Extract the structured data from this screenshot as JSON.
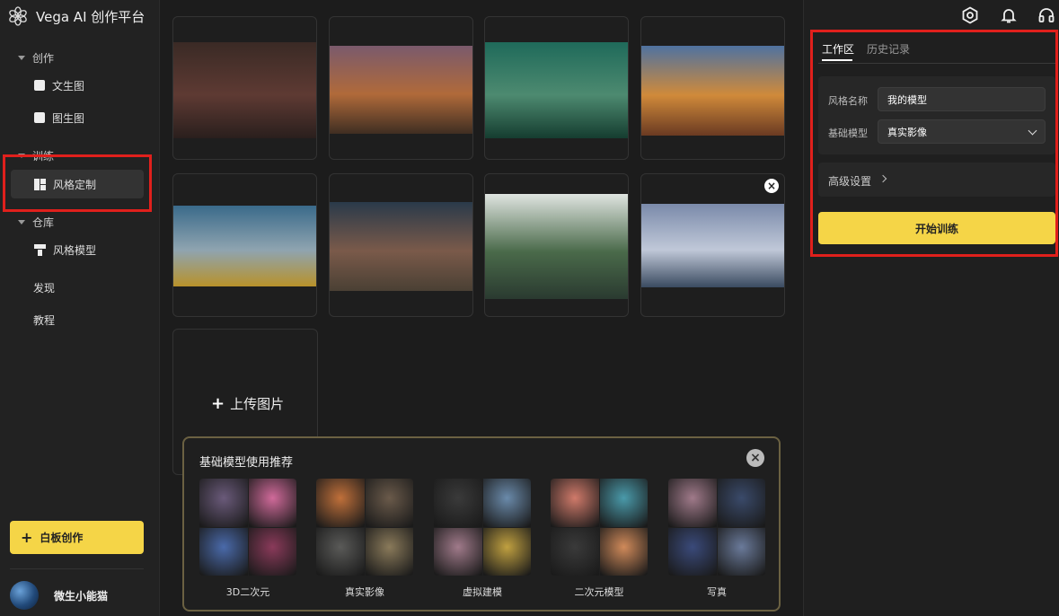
{
  "app": {
    "title": "Vega AI 创作平台"
  },
  "sidebar": {
    "groups": [
      {
        "label": "创作",
        "items": [
          {
            "label": "文生图",
            "icon": "image-text-icon"
          },
          {
            "label": "图生图",
            "icon": "image-icon"
          }
        ]
      },
      {
        "label": "训练",
        "items": [
          {
            "label": "风格定制",
            "icon": "style-custom-icon",
            "active": true
          }
        ]
      },
      {
        "label": "仓库",
        "items": [
          {
            "label": "风格模型",
            "icon": "style-model-icon"
          }
        ]
      }
    ],
    "plain_items": [
      "发现",
      "教程"
    ],
    "whiteboard_button": "白板创作",
    "user": {
      "name": "微生小能猫"
    }
  },
  "main": {
    "images": [
      {
        "name": "berry-branch",
        "colors": [
          "#3a2a25",
          "#5e3a33",
          "#2a1f1d"
        ]
      },
      {
        "name": "canyon-sunset",
        "colors": [
          "#7a5a6c",
          "#b06a3a",
          "#3f2e22"
        ]
      },
      {
        "name": "green-gorge",
        "colors": [
          "#1f6a5a",
          "#4d8a70",
          "#153d30"
        ]
      },
      {
        "name": "autumn-lake",
        "colors": [
          "#4f72a0",
          "#d08a3a",
          "#6a3a22"
        ]
      },
      {
        "name": "river-shore",
        "colors": [
          "#3a6a8a",
          "#8fa4b0",
          "#b8922a"
        ]
      },
      {
        "name": "desert-rock",
        "colors": [
          "#2a3a4a",
          "#7a5a4a",
          "#4a4034"
        ]
      },
      {
        "name": "misty-lake",
        "colors": [
          "#dfe4e0",
          "#4a6a4a",
          "#2a3a30"
        ]
      },
      {
        "name": "snow-valley",
        "colors": [
          "#7a8aaa",
          "#c0c8d8",
          "#3a4a60"
        ]
      }
    ],
    "upload_label": "上传图片"
  },
  "recommend": {
    "title": "基础模型使用推荐",
    "items": [
      {
        "label": "3D二次元",
        "colors": [
          "#6a5a7a",
          "#d06a9a",
          "#4a6aaa",
          "#8a3a5a"
        ]
      },
      {
        "label": "真实影像",
        "colors": [
          "#c0703a",
          "#6a5a4a",
          "#5a5a58",
          "#8a7a5a"
        ]
      },
      {
        "label": "虚拟建模",
        "colors": [
          "#3a3a3a",
          "#6a8aaa",
          "#a07a8a",
          "#c0a040"
        ]
      },
      {
        "label": "二次元模型",
        "colors": [
          "#d07a6a",
          "#4a9aaa",
          "#3a3a3a",
          "#d08a5a"
        ]
      },
      {
        "label": "写真",
        "colors": [
          "#a07a8a",
          "#3a4a6a",
          "#3a4a7a",
          "#6a7a9a"
        ]
      }
    ]
  },
  "rpanel": {
    "tabs": [
      "工作区",
      "历史记录"
    ],
    "fields": {
      "name_label": "风格名称",
      "name_value": "我的模型",
      "model_label": "基础模型",
      "model_value": "真实影像"
    },
    "advanced": "高级设置",
    "train_button": "开始训练"
  },
  "colors": {
    "accent": "#f5d547",
    "highlight": "#e0201c"
  }
}
